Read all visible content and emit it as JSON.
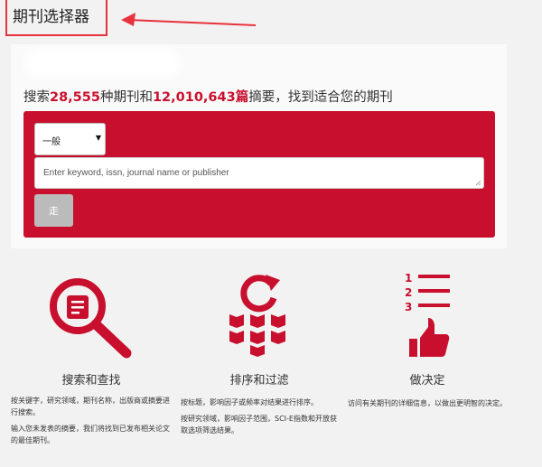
{
  "header": {
    "title": "期刊选择器"
  },
  "search": {
    "headline_prefix": "搜索",
    "journal_count": "28,555",
    "headline_mid": "种期刊和",
    "abstract_count": "12,010,643篇",
    "headline_suffix": "摘要，找到适合您的期刊",
    "select_value": "一般",
    "placeholder": "Enter keyword, issn, journal name or publisher",
    "go_label": "走"
  },
  "features": [
    {
      "title": "搜索和查找",
      "icon": "magnifier-document-icon",
      "paragraphs": [
        "按关键字，研究领域，期刊名称，出版商或摘要进行搜索。",
        "输入您未发表的摘要，我们将找到已发布相关论文的最佳期刊。"
      ]
    },
    {
      "title": "排序和过滤",
      "icon": "refresh-books-icon",
      "paragraphs": [
        "按标题，影响因子或频率对结果进行排序。",
        "按研究领域，影响因子范围，SCI-E指数和开放获取选项筛选结果。"
      ]
    },
    {
      "title": "做决定",
      "icon": "list-thumbs-up-icon",
      "paragraphs": [
        "访问有关期刊的详细信息，以做出更明智的决定。"
      ]
    }
  ],
  "colors": {
    "brand_red": "#c8102e",
    "annotation_red": "#e8323c",
    "background": "#f2f2f2"
  }
}
